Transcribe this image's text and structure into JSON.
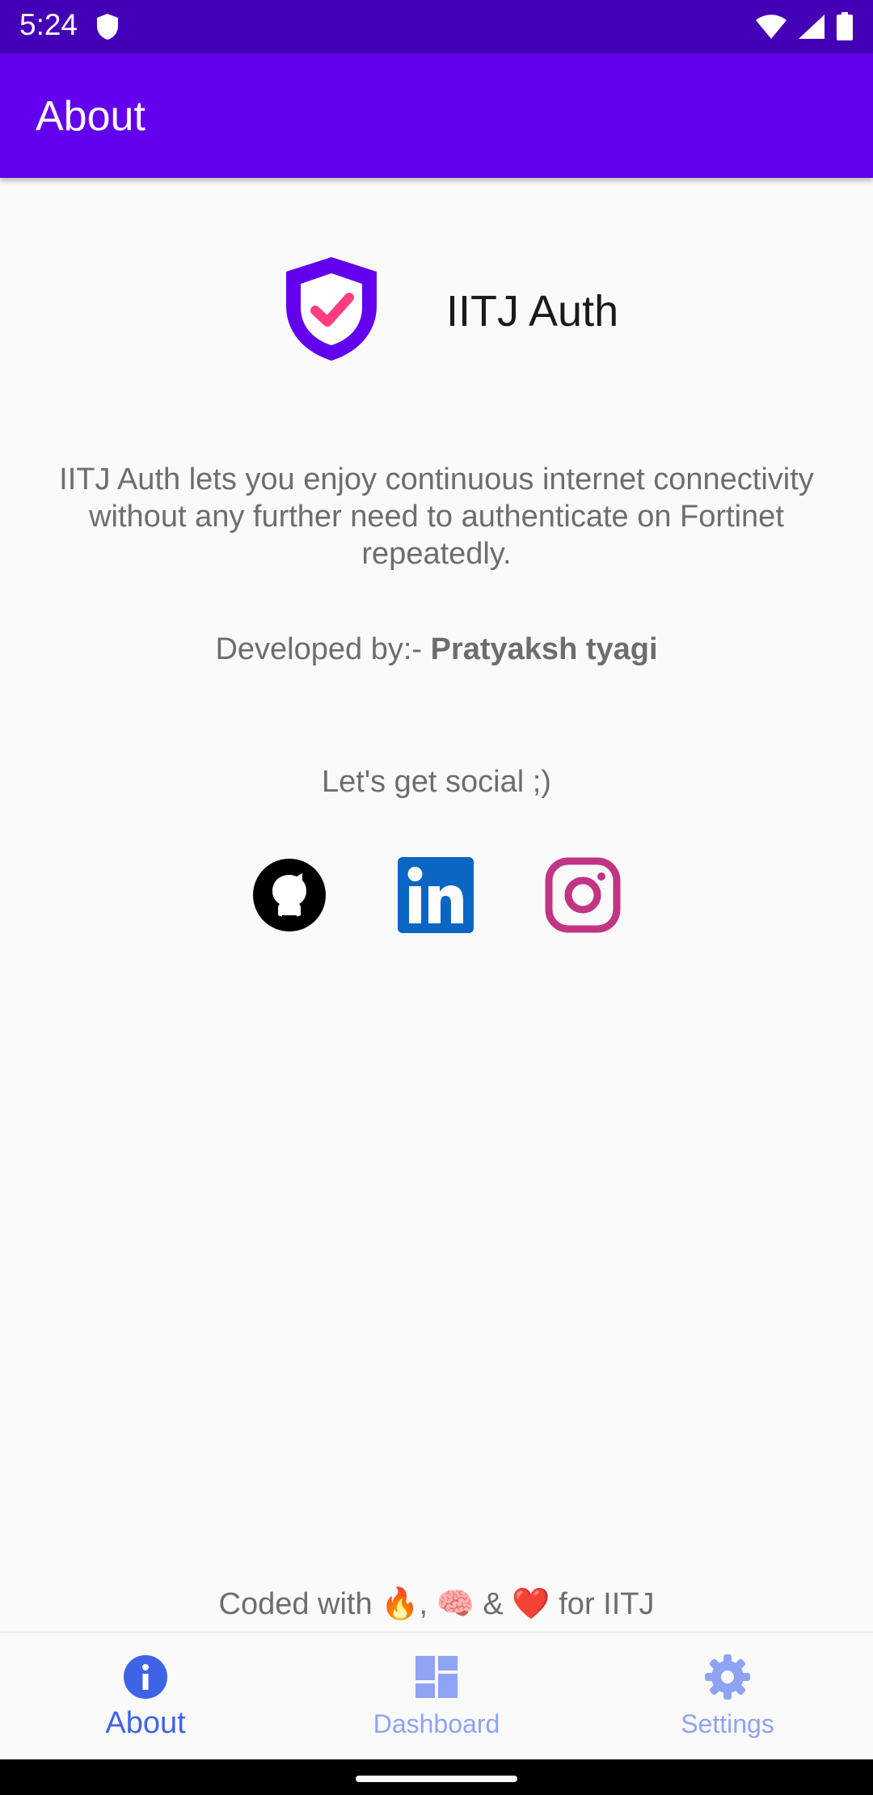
{
  "status_bar": {
    "time": "5:24"
  },
  "app_bar": {
    "title": "About"
  },
  "brand": {
    "name": "IITJ Auth"
  },
  "description": "IITJ Auth lets you enjoy continuous internet connectivity without any further need to authenticate on Fortinet repeatedly.",
  "developer": {
    "label": "Developed by:- ",
    "name": "Pratyaksh tyagi"
  },
  "social": {
    "heading": "Let's get social ;)",
    "links": [
      {
        "icon": "github-icon"
      },
      {
        "icon": "linkedin-icon"
      },
      {
        "icon": "instagram-icon"
      }
    ]
  },
  "footer": {
    "note": "Coded with 🔥, 🧠 & ❤️ for IITJ"
  },
  "bottom_nav": {
    "items": [
      {
        "label": "About",
        "icon": "info-icon",
        "active": true
      },
      {
        "label": "Dashboard",
        "icon": "dashboard-icon",
        "active": false
      },
      {
        "label": "Settings",
        "icon": "gear-icon",
        "active": false
      }
    ]
  },
  "colors": {
    "status_bar": "#4400b6",
    "app_bar": "#6200ee",
    "brand_shield": "#6200ee",
    "brand_check": "#ff3d7f",
    "nav_active": "#3f63e6",
    "nav_inactive": "#8fa3f5",
    "linkedin": "#0a66c2",
    "instagram": "#c13584"
  }
}
